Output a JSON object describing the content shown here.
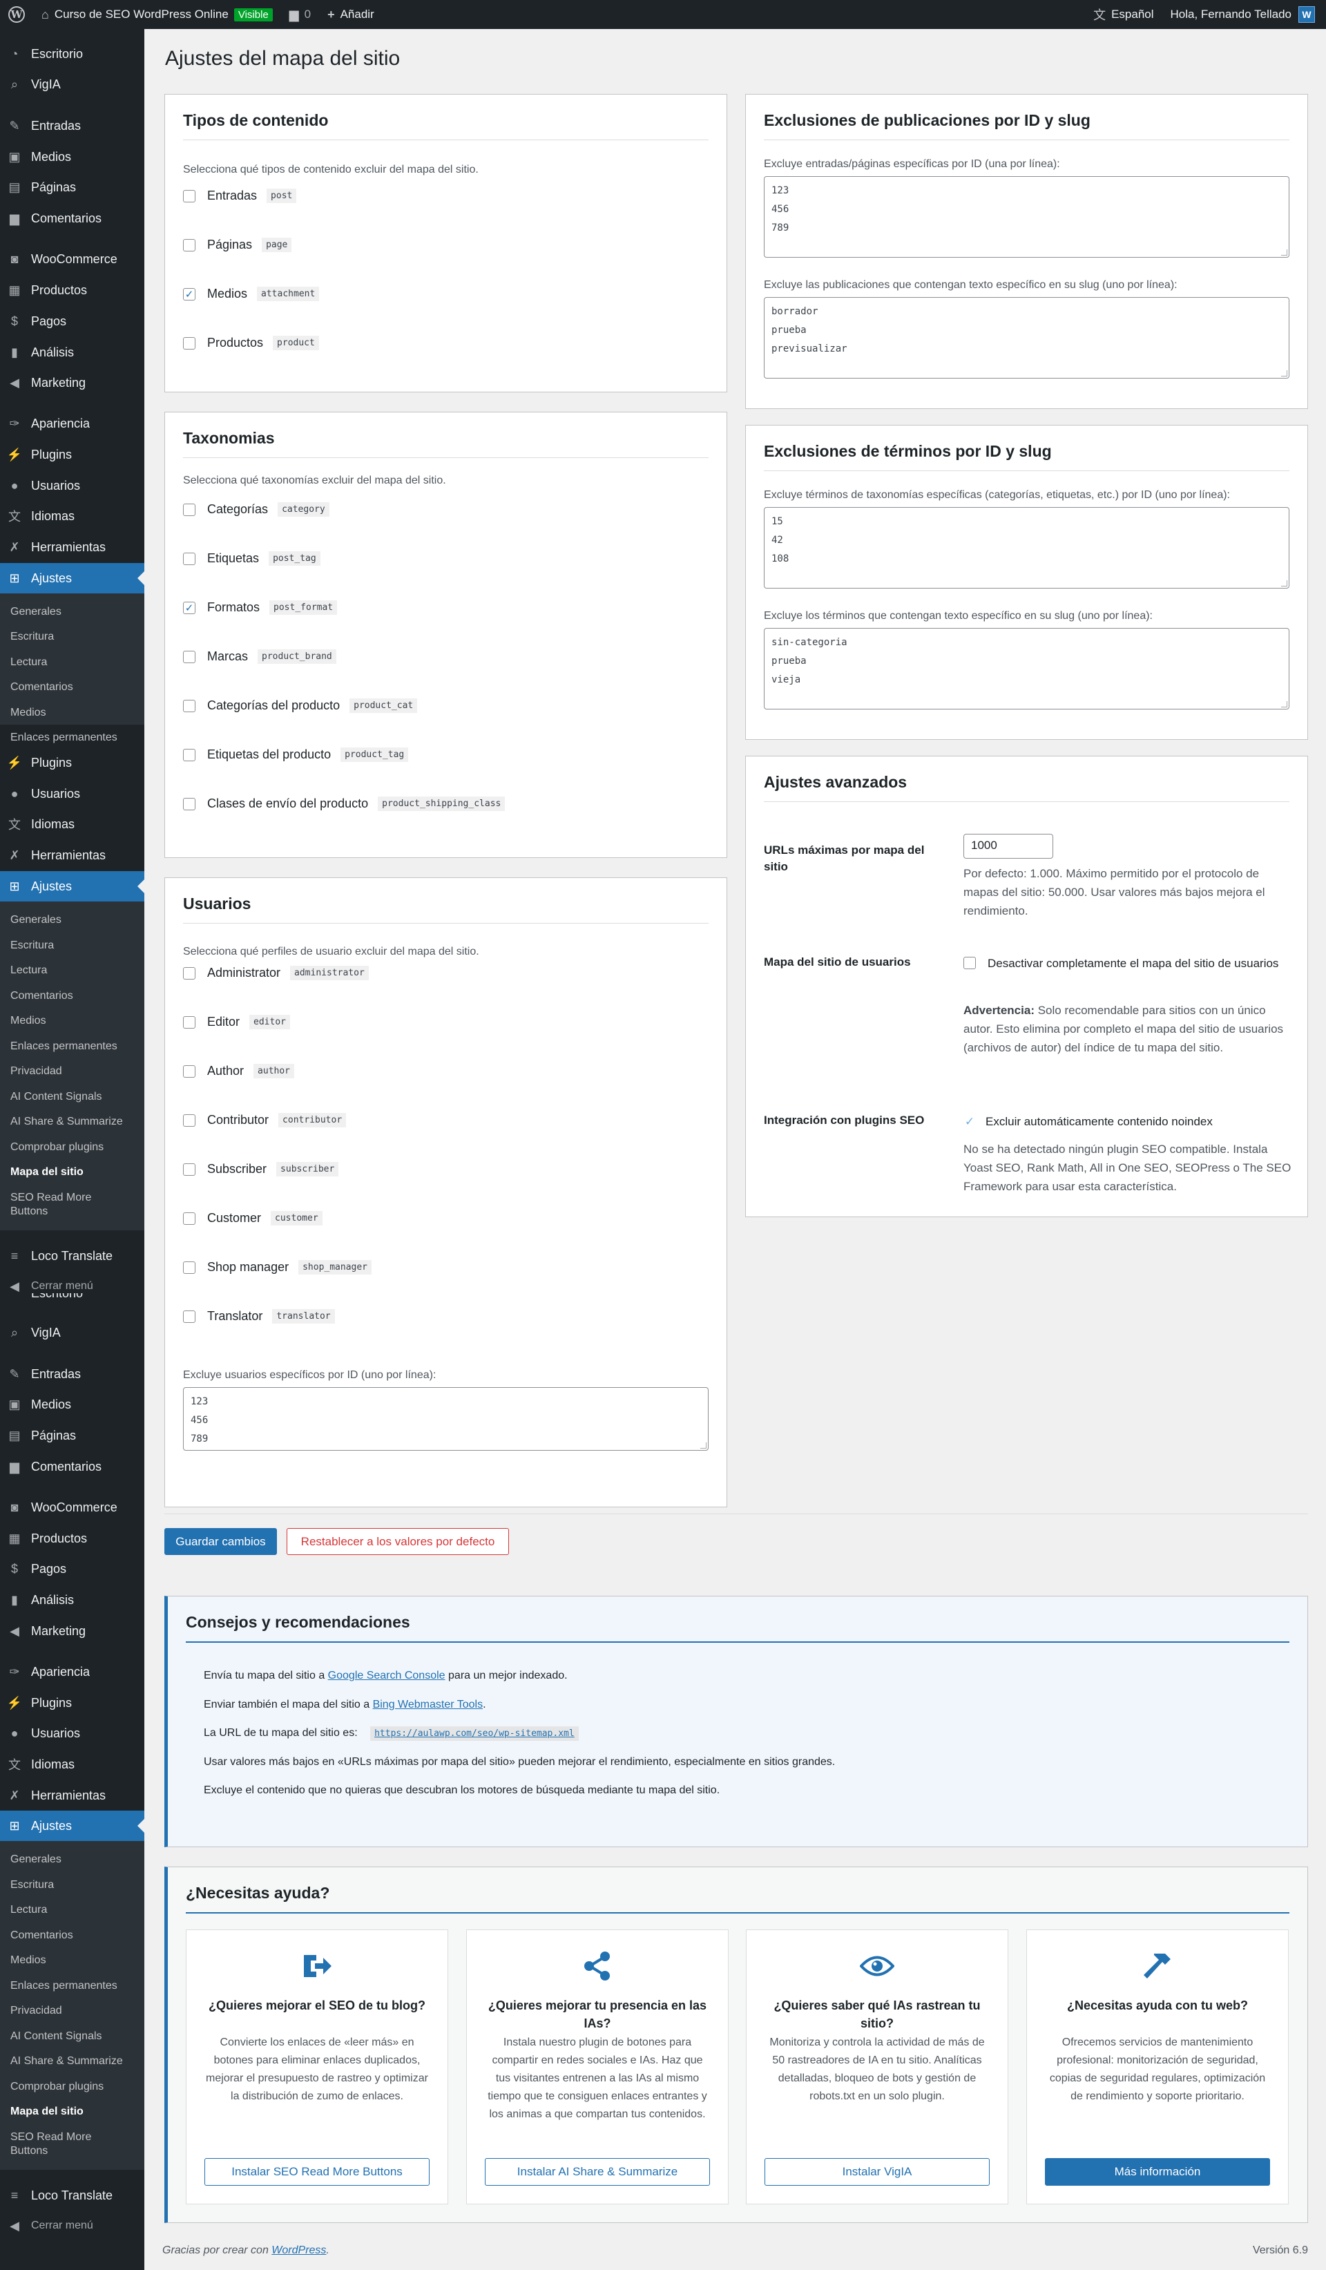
{
  "adminbar": {
    "site_name": "Curso de SEO WordPress Online",
    "visible_badge": "Visible",
    "comments_count": "0",
    "add_new": "Añadir",
    "language": "Español",
    "greeting": "Hola, Fernando Tellado"
  },
  "sidebar": {
    "escritorio": "Escritorio",
    "vigia": "VigIA",
    "entradas": "Entradas",
    "medios": "Medios",
    "paginas": "Páginas",
    "comentarios": "Comentarios",
    "woocommerce": "WooCommerce",
    "productos": "Productos",
    "pagos": "Pagos",
    "analisis": "Análisis",
    "marketing": "Marketing",
    "apariencia": "Apariencia",
    "plugins": "Plugins",
    "usuarios": "Usuarios",
    "idiomas": "Idiomas",
    "herramientas": "Herramientas",
    "ajustes": "Ajustes",
    "loco": "Loco Translate",
    "cerrar": "Cerrar menú",
    "sub": {
      "generales": "Generales",
      "escritura": "Escritura",
      "lectura": "Lectura",
      "comentarios": "Comentarios",
      "medios": "Medios",
      "enlaces": "Enlaces permanentes",
      "privacidad": "Privacidad",
      "ai_signals": "AI Content Signals",
      "ai_share": "AI Share & Summarize",
      "comprobar": "Comprobar plugins",
      "mapa": "Mapa del sitio",
      "seo_read_1": "SEO Read More",
      "seo_read_2": "Buttons"
    }
  },
  "page": {
    "title": "Ajustes del mapa del sitio"
  },
  "content_types": {
    "title": "Tipos de contenido",
    "desc": "Selecciona qué tipos de contenido excluir del mapa del sitio.",
    "items": [
      {
        "label": "Entradas",
        "code": "post",
        "checked": false
      },
      {
        "label": "Páginas",
        "code": "page",
        "checked": false
      },
      {
        "label": "Medios",
        "code": "attachment",
        "checked": true
      },
      {
        "label": "Productos",
        "code": "product",
        "checked": false
      }
    ]
  },
  "taxonomies": {
    "title": "Taxonomias",
    "desc": "Selecciona qué taxonomías excluir del mapa del sitio.",
    "items": [
      {
        "label": "Categorías",
        "code": "category",
        "checked": false
      },
      {
        "label": "Etiquetas",
        "code": "post_tag",
        "checked": false
      },
      {
        "label": "Formatos",
        "code": "post_format",
        "checked": true
      },
      {
        "label": "Marcas",
        "code": "product_brand",
        "checked": false
      },
      {
        "label": "Categorías del producto",
        "code": "product_cat",
        "checked": false
      },
      {
        "label": "Etiquetas del producto",
        "code": "product_tag",
        "checked": false
      },
      {
        "label": "Clases de envío del producto",
        "code": "product_shipping_class",
        "checked": false
      }
    ]
  },
  "users": {
    "title": "Usuarios",
    "desc": "Selecciona qué perfiles de usuario excluir del mapa del sitio.",
    "items": [
      {
        "label": "Administrator",
        "code": "administrator",
        "checked": false
      },
      {
        "label": "Editor",
        "code": "editor",
        "checked": false
      },
      {
        "label": "Author",
        "code": "author",
        "checked": false
      },
      {
        "label": "Contributor",
        "code": "contributor",
        "checked": false
      },
      {
        "label": "Subscriber",
        "code": "subscriber",
        "checked": false
      },
      {
        "label": "Customer",
        "code": "customer",
        "checked": false
      },
      {
        "label": "Shop manager",
        "code": "shop_manager",
        "checked": false
      },
      {
        "label": "Translator",
        "code": "translator",
        "checked": false
      }
    ],
    "exclude_label": "Excluye usuarios específicos por ID (uno por línea):",
    "exclude_value": "123\n456\n789"
  },
  "post_exclusions": {
    "title": "Exclusiones de publicaciones por ID y slug",
    "ids_label": "Excluye entradas/páginas específicas por ID (una por línea):",
    "ids_value": "123\n456\n789",
    "slugs_label": "Excluye las publicaciones que contengan texto específico en su slug (uno por línea):",
    "slugs_value": "borrador\nprueba\nprevisualizar"
  },
  "term_exclusions": {
    "title": "Exclusiones de términos por ID y slug",
    "ids_label": "Excluye términos de taxonomías específicas (categorías, etiquetas, etc.) por ID (uno por línea):",
    "ids_value": "15\n42\n108",
    "slugs_label": "Excluye los términos que contengan texto específico en su slug (uno por línea):",
    "slugs_value": "sin-categoria\nprueba\nvieja"
  },
  "advanced": {
    "title": "Ajustes avanzados",
    "max_urls_label": "URLs máximas por mapa del sitio",
    "max_urls_value": "1000",
    "max_urls_help": "Por defecto: 1.000. Máximo permitido por el protocolo de mapas del sitio: 50.000. Usar valores más bajos mejora el rendimiento.",
    "user_sitemap_label": "Mapa del sitio de usuarios",
    "user_sitemap_option": "Desactivar completamente el mapa del sitio de usuarios",
    "user_sitemap_warn_strong": "Advertencia:",
    "user_sitemap_warn": "Solo recomendable para sitios con un único autor. Esto elimina por completo el mapa del sitio de usuarios (archivos de autor) del índice de tu mapa del sitio.",
    "seo_label": "Integración con plugins SEO",
    "seo_option": "Excluir automáticamente contenido noindex",
    "seo_help": "No se ha detectado ningún plugin SEO compatible. Instala Yoast SEO, Rank Math, All in One SEO, SEOPress o The SEO Framework para usar esta característica."
  },
  "actions": {
    "save": "Guardar cambios",
    "reset": "Restablecer a los valores por defecto"
  },
  "tips": {
    "title": "Consejos y recomendaciones",
    "t1_pre": "Envía tu mapa del sitio a",
    "t1_link": "Google Search Console",
    "t1_post": "para un mejor indexado.",
    "t2_pre": "Enviar también el mapa del sitio a",
    "t2_link": "Bing Webmaster Tools",
    "t2_post": ".",
    "t3_pre": "La URL de tu mapa del sitio es:",
    "t3_code": "https://aulawp.com/seo/wp-sitemap.xml",
    "t4": "Usar valores más bajos en «URLs máximas por mapa del sitio» pueden mejorar el rendimiento, especialmente en sitios grandes.",
    "t5": "Excluye el contenido que no quieras que descubran los motores de búsqueda mediante tu mapa del sitio."
  },
  "help": {
    "title": "¿Necesitas ayuda?",
    "cards": [
      {
        "title": "¿Quieres mejorar el SEO de tu blog?",
        "text": "Convierte los enlaces de «leer más» en botones para eliminar enlaces duplicados, mejorar el presupuesto de rastreo y optimizar la distribución de zumo de enlaces.",
        "button": "Instalar SEO Read More Buttons"
      },
      {
        "title": "¿Quieres mejorar tu presencia en las IAs?",
        "text": "Instala nuestro plugin de botones para compartir en redes sociales e IAs. Haz que tus visitantes entrenen a las IAs al mismo tiempo que te consiguen enlaces entrantes y los animas a que compartan tus contenidos.",
        "button": "Instalar AI Share & Summarize"
      },
      {
        "title": "¿Quieres saber qué IAs rastrean tu sitio?",
        "text": "Monitoriza y controla la actividad de más de 50 rastreadores de IA en tu sitio. Analíticas detalladas, bloqueo de bots y gestión de robots.txt en un solo plugin.",
        "button": "Instalar VigIA"
      },
      {
        "title": "¿Necesitas ayuda con tu web?",
        "text": "Ofrecemos servicios de mantenimiento profesional: monitorización de seguridad, copias de seguridad regulares, optimización de rendimiento y soporte prioritario.",
        "button": "Más información"
      }
    ]
  },
  "footer": {
    "thanks_pre": "Gracias por crear con",
    "thanks_link": "WordPress",
    "thanks_post": ".",
    "version": "Versión 6.9"
  },
  "colors": {
    "accent": "#2271b1",
    "sidebar": "#1d2327",
    "danger": "#d63638"
  }
}
